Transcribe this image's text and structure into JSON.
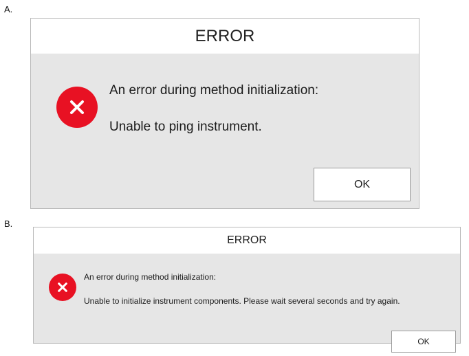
{
  "panel_a": {
    "label": "A.",
    "dialog": {
      "title": "ERROR",
      "icon": "error-x-icon",
      "message_line1": "An error during method initialization:",
      "message_line2": "Unable to ping instrument.",
      "ok_label": "OK"
    }
  },
  "panel_b": {
    "label": "B.",
    "dialog": {
      "title": "ERROR",
      "icon": "error-x-icon",
      "message_line1": "An error during method initialization:",
      "message_line2": "Unable to initialize instrument components. Please wait several seconds and try again.",
      "ok_label": "OK"
    }
  },
  "colors": {
    "error_red": "#e81123",
    "dialog_body": "#e6e6e6",
    "titlebar": "#ffffff"
  }
}
